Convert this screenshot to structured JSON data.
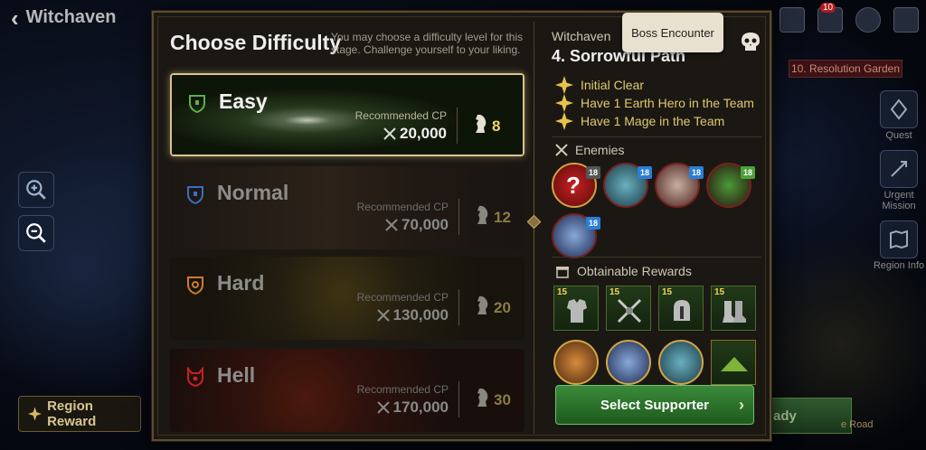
{
  "top_bar": {
    "back_label": "Witchaven",
    "mail_badge": "10"
  },
  "map": {
    "region_label": "10. Resolution Garden",
    "region_reward_label": "Region Reward",
    "ready_label": "ady",
    "road_label": "e Road"
  },
  "side_menu": [
    {
      "label": "Quest",
      "icon": "quest-icon"
    },
    {
      "label": "Urgent Mission",
      "icon": "urgent-mission-icon"
    },
    {
      "label": "Region Info",
      "icon": "region-info-icon"
    }
  ],
  "dialog": {
    "title": "Choose Difficulty",
    "subtitle": "You may choose a difficulty level for this stage. Challenge yourself to your liking.",
    "difficulties": [
      {
        "name": "Easy",
        "rec_label": "Recommended CP",
        "cp": "20,000",
        "level": "8",
        "color": "#5fb04a",
        "selected": true
      },
      {
        "name": "Normal",
        "rec_label": "Recommended CP",
        "cp": "70,000",
        "level": "12",
        "color": "#3a6fc0",
        "selected": false
      },
      {
        "name": "Hard",
        "rec_label": "Recommended CP",
        "cp": "130,000",
        "level": "20",
        "color": "#d17a2a",
        "selected": false
      },
      {
        "name": "Hell",
        "rec_label": "Recommended CP",
        "cp": "170,000",
        "level": "30",
        "color": "#c72222",
        "selected": false
      }
    ],
    "stage": {
      "region": "Witchaven",
      "name": "4. Sorrowful Path",
      "boss_tooltip": "Boss Encounter",
      "missions": [
        "Initial Clear",
        "Have 1 Earth Hero in the Team",
        "Have 1 Mage in the Team"
      ],
      "enemies_label": "Enemies",
      "enemies": [
        {
          "level": "18",
          "element": "unknown",
          "badge_color": "#555555"
        },
        {
          "level": "18",
          "element": "water",
          "badge_color": "#2a7fd4"
        },
        {
          "level": "18",
          "element": "water",
          "badge_color": "#2a7fd4"
        },
        {
          "level": "18",
          "element": "earth",
          "badge_color": "#4aa33a"
        },
        {
          "level": "18",
          "element": "water",
          "badge_color": "#2a7fd4"
        }
      ],
      "rewards_label": "Obtainable Rewards",
      "rewards": [
        {
          "level": "15",
          "icon": "armor-icon"
        },
        {
          "level": "15",
          "icon": "weapon-icon"
        },
        {
          "level": "15",
          "icon": "helmet-icon"
        },
        {
          "level": "15",
          "icon": "boots-icon"
        }
      ],
      "select_supporter_label": "Select Supporter"
    }
  }
}
